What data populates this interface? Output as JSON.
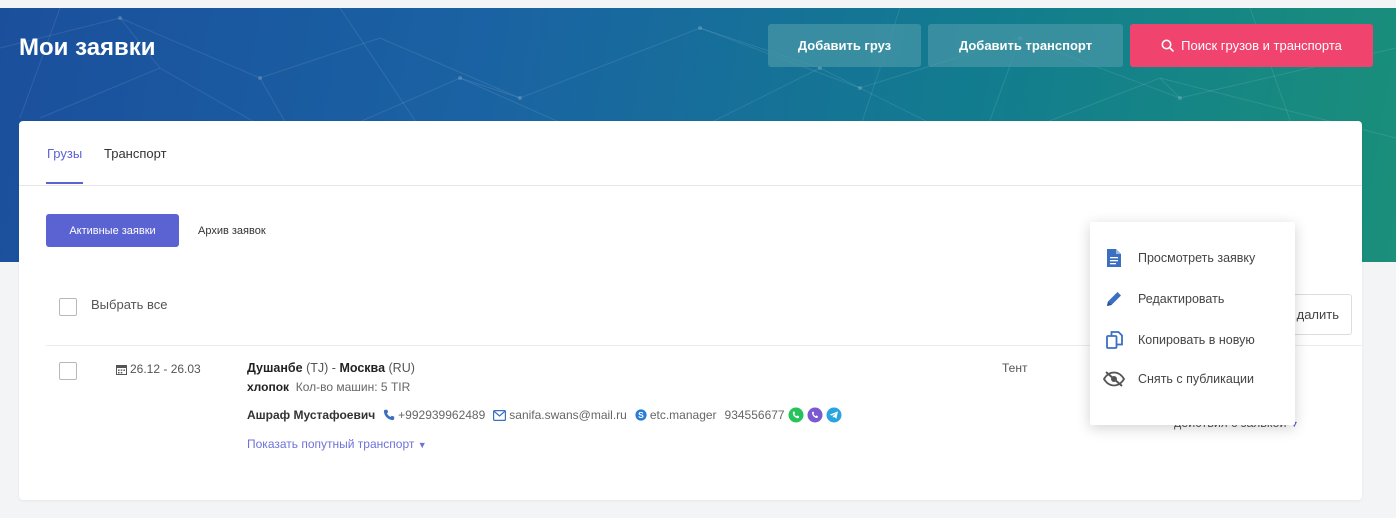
{
  "header": {
    "title": "Мои заявки",
    "add_cargo": "Добавить груз",
    "add_transport": "Добавить транспорт",
    "search": "Поиск грузов и транспорта"
  },
  "tabs": [
    {
      "label": "Грузы",
      "active": true
    },
    {
      "label": "Транспорт",
      "active": false
    }
  ],
  "filters": {
    "active": "Активные заявки",
    "archive": "Архив заявок"
  },
  "list": {
    "select_all": "Выбрать все",
    "delete": "далить"
  },
  "row": {
    "dates": "26.12 - 26.03",
    "from_city": "Душанбе",
    "from_country": "(TJ)",
    "separator": "-",
    "to_city": "Москва",
    "to_country": "(RU)",
    "cargo_name": "хлопок",
    "cargo_details": "Кол-во машин: 5  TIR",
    "contact_name": "Ашраф Мустафоевич",
    "phone": "+992939962489",
    "email": "sanifa.swans@mail.ru",
    "skype": "etc.manager",
    "messenger_number": "934556677",
    "show_transport": "Показать попутный транспорт",
    "body_type": "Тент",
    "actions": "действия с заявкой",
    "partial_digit": "з"
  },
  "dropdown": [
    {
      "icon": "document-icon",
      "label": "Просмотреть заявку"
    },
    {
      "icon": "pencil-icon",
      "label": "Редактировать"
    },
    {
      "icon": "copy-icon",
      "label": "Копировать в новую"
    },
    {
      "icon": "eye-slash-icon",
      "label": "Снять с публикации"
    }
  ],
  "colors": {
    "accent": "#5b63d3",
    "pink": "#f0436e",
    "whatsapp": "#25c35a",
    "viber": "#7b5ad1",
    "telegram": "#2aa4e0",
    "icon_blue": "#3a6fc2"
  }
}
